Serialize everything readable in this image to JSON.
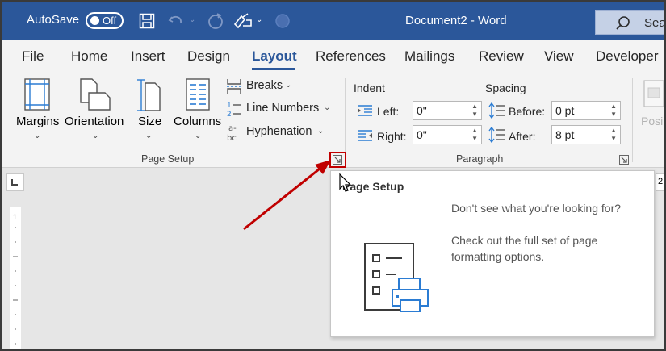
{
  "titlebar": {
    "autosave_label": "AutoSave",
    "autosave_state": "Off",
    "document_title": "Document2  -  Word",
    "search_placeholder": "Sea",
    "colors": {
      "background": "#2b579a",
      "text": "#ffffff"
    }
  },
  "tabs": [
    {
      "label": "File"
    },
    {
      "label": "Home"
    },
    {
      "label": "Insert"
    },
    {
      "label": "Design"
    },
    {
      "label": "Layout",
      "active": true
    },
    {
      "label": "References"
    },
    {
      "label": "Mailings"
    },
    {
      "label": "Review"
    },
    {
      "label": "View"
    },
    {
      "label": "Developer"
    }
  ],
  "page_setup": {
    "margins_label": "Margins",
    "orientation_label": "Orientation",
    "size_label": "Size",
    "columns_label": "Columns",
    "breaks_label": "Breaks",
    "line_numbers_label": "Line Numbers",
    "hyphenation_label": "Hyphenation",
    "group_label": "Page Setup"
  },
  "paragraph": {
    "indent_heading": "Indent",
    "spacing_heading": "Spacing",
    "left_label": "Left:",
    "left_value": "0\"",
    "right_label": "Right:",
    "right_value": "0\"",
    "before_label": "Before:",
    "before_value": "0 pt",
    "after_label": "After:",
    "after_value": "8 pt",
    "group_label": "Paragraph"
  },
  "arrange": {
    "position_partial_label": "Posi"
  },
  "ruler": {
    "page_edge_number": "2",
    "vruler_number": "1"
  },
  "tooltip": {
    "title": "Page Setup",
    "line1": "Don't see what you're looking for?",
    "line2": "Check out the full set of page formatting options."
  },
  "annotation": {
    "arrow_color": "#c00000"
  }
}
